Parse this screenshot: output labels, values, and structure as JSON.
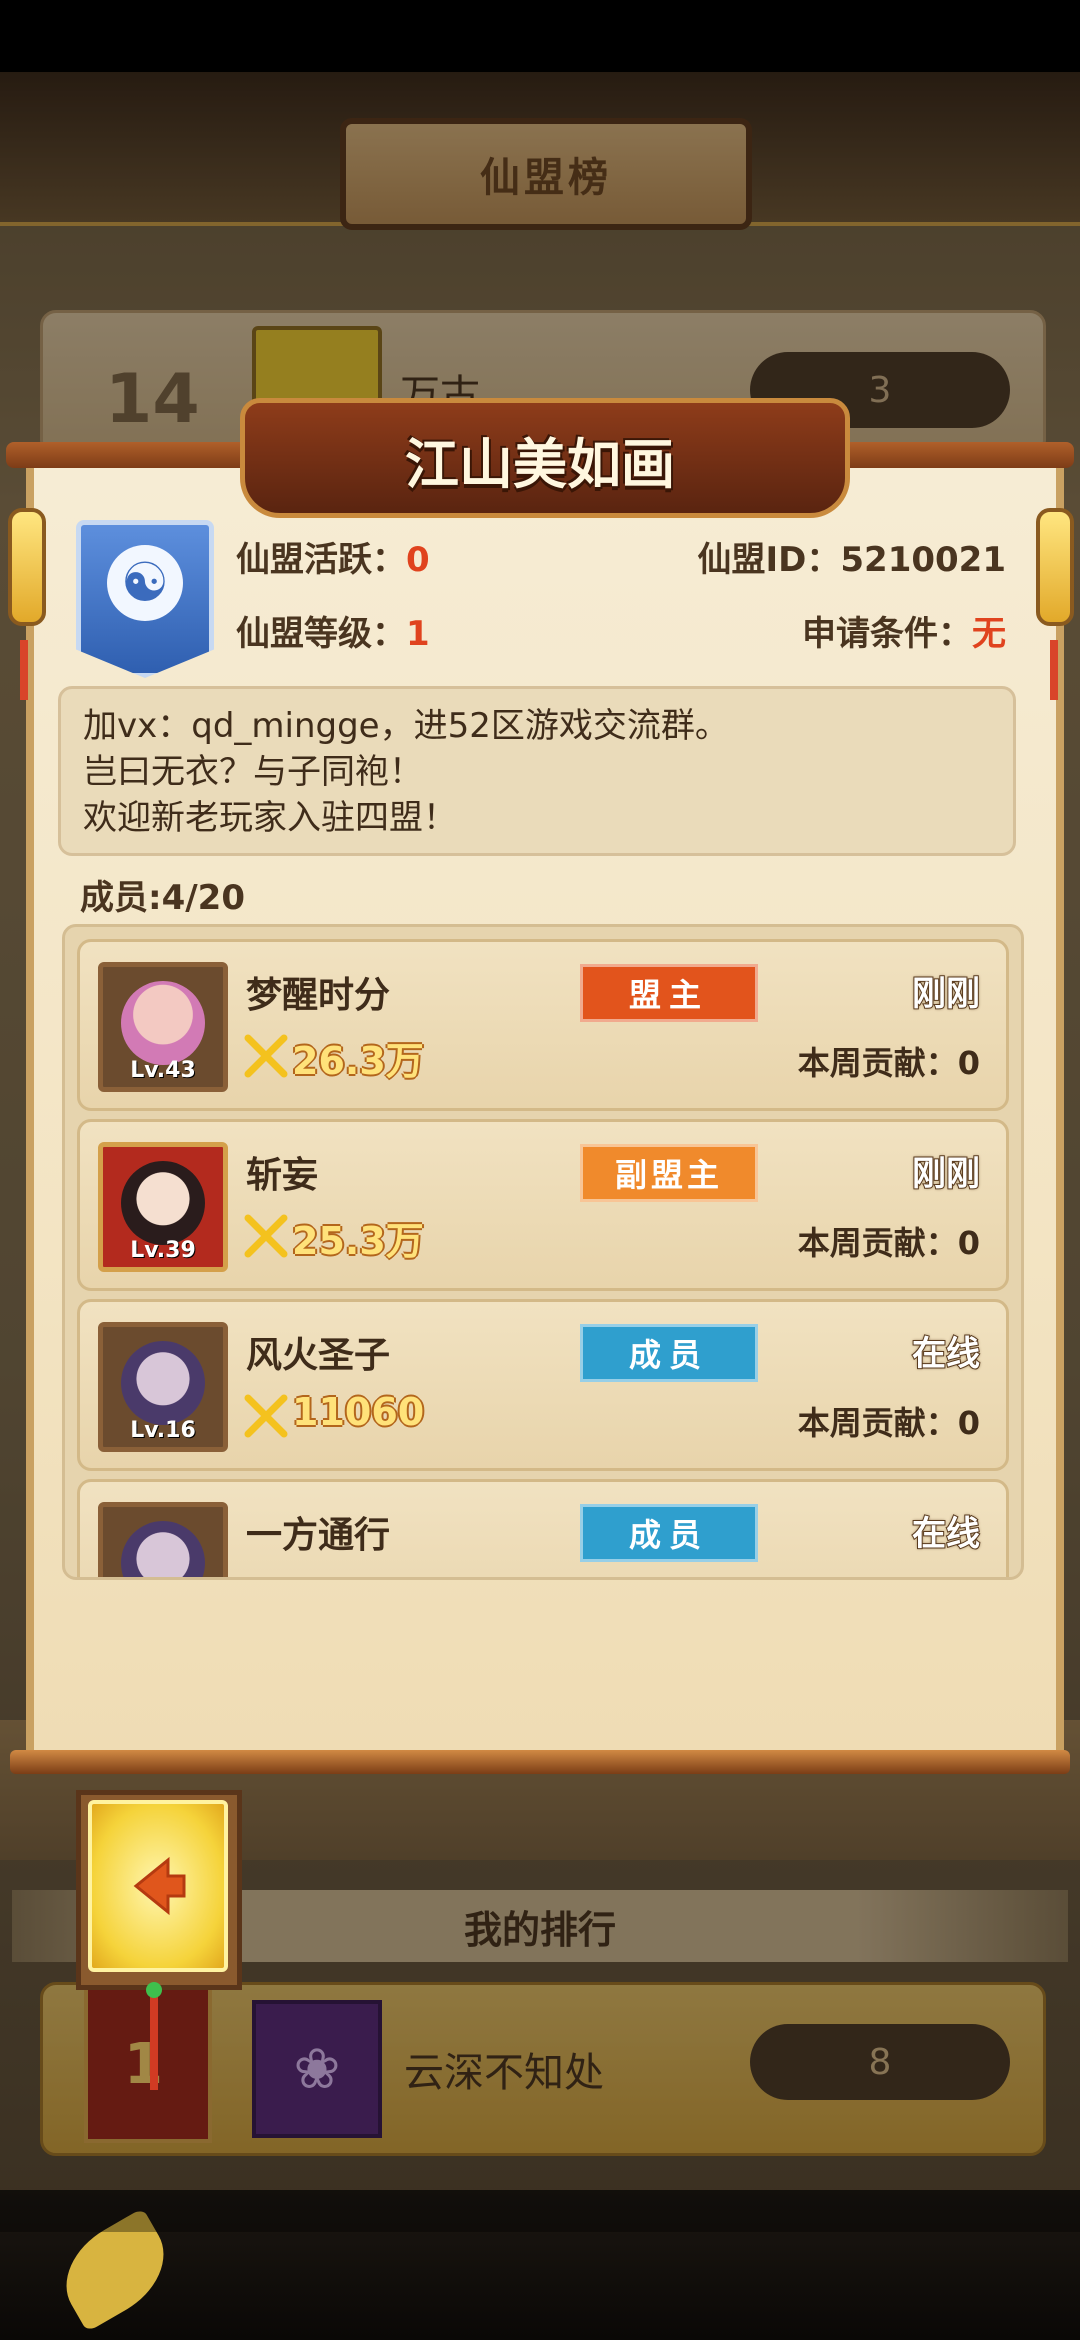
{
  "background": {
    "title": "仙盟榜",
    "row_14": {
      "rank": "14",
      "name": "万古",
      "count": "3"
    },
    "partial_name": "江山美如画",
    "my_rank_label": "我的排行",
    "my_row": {
      "rank": "1",
      "name": "云深不知处",
      "count": "8"
    }
  },
  "guild": {
    "name": "江山美如画",
    "activity_label": "仙盟活跃：",
    "activity_value": "0",
    "id_label": "仙盟ID：",
    "id_value": "5210021",
    "level_label": "仙盟等级：",
    "level_value": "1",
    "condition_label": "申请条件：",
    "condition_value": "无",
    "emblem_icon": "yin-yang-icon"
  },
  "notice": [
    "加vx：qd_mingge，进52区游戏交流群。",
    "岂曰无衣？与子同袍！",
    "欢迎新老玩家入驻四盟！"
  ],
  "members_label": "成员:4/20",
  "members": [
    {
      "name": "梦醒时分",
      "role": "盟主",
      "status": "刚刚",
      "power": "26.3万",
      "contrib_label": "本周贡献：",
      "contrib": "0",
      "level": "Lv.43"
    },
    {
      "name": "斩妄",
      "role": "副盟主",
      "status": "刚刚",
      "power": "25.3万",
      "contrib_label": "本周贡献：",
      "contrib": "0",
      "level": "Lv.39"
    },
    {
      "name": "风火圣子",
      "role": "成员",
      "status": "在线",
      "power": "11060",
      "contrib_label": "本周贡献：",
      "contrib": "0",
      "level": "Lv.16"
    },
    {
      "name": "一方通行",
      "role": "成员",
      "status": "在线",
      "power": "",
      "contrib_label": "",
      "contrib": "",
      "level": ""
    }
  ],
  "colors": {
    "leader_badge": "#e2541c",
    "vice_badge": "#f08a2c",
    "member_badge": "#2f9fce",
    "red_value": "#e0431e"
  },
  "icons": {
    "back": "back-arrow-icon",
    "power": "crossed-swords-icon"
  }
}
